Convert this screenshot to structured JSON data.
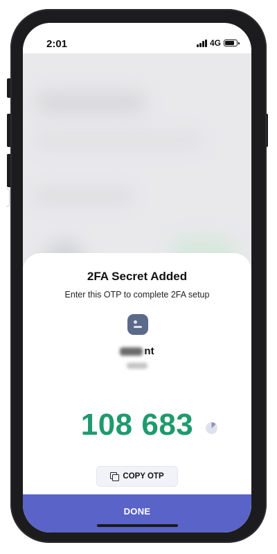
{
  "status_bar": {
    "time": "2:01",
    "network": "4G",
    "icons": [
      "signal-icon",
      "battery-icon"
    ]
  },
  "sheet": {
    "title": "2FA Secret Added",
    "subtitle": "Enter this OTP to complete 2FA setup",
    "account_icon": "account-icon",
    "account_name_visible": "nt",
    "otp_code": "108 683",
    "timer_progress": 0.13,
    "copy_button_label": "COPY OTP",
    "copy_icon": "copy-icon"
  },
  "footer": {
    "done_label": "DONE"
  },
  "colors": {
    "otp_green": "#1f9a6e",
    "done_button": "#5a63c7",
    "account_icon_bg": "#5c6a8a",
    "copy_button_bg": "#f2f3f8"
  }
}
